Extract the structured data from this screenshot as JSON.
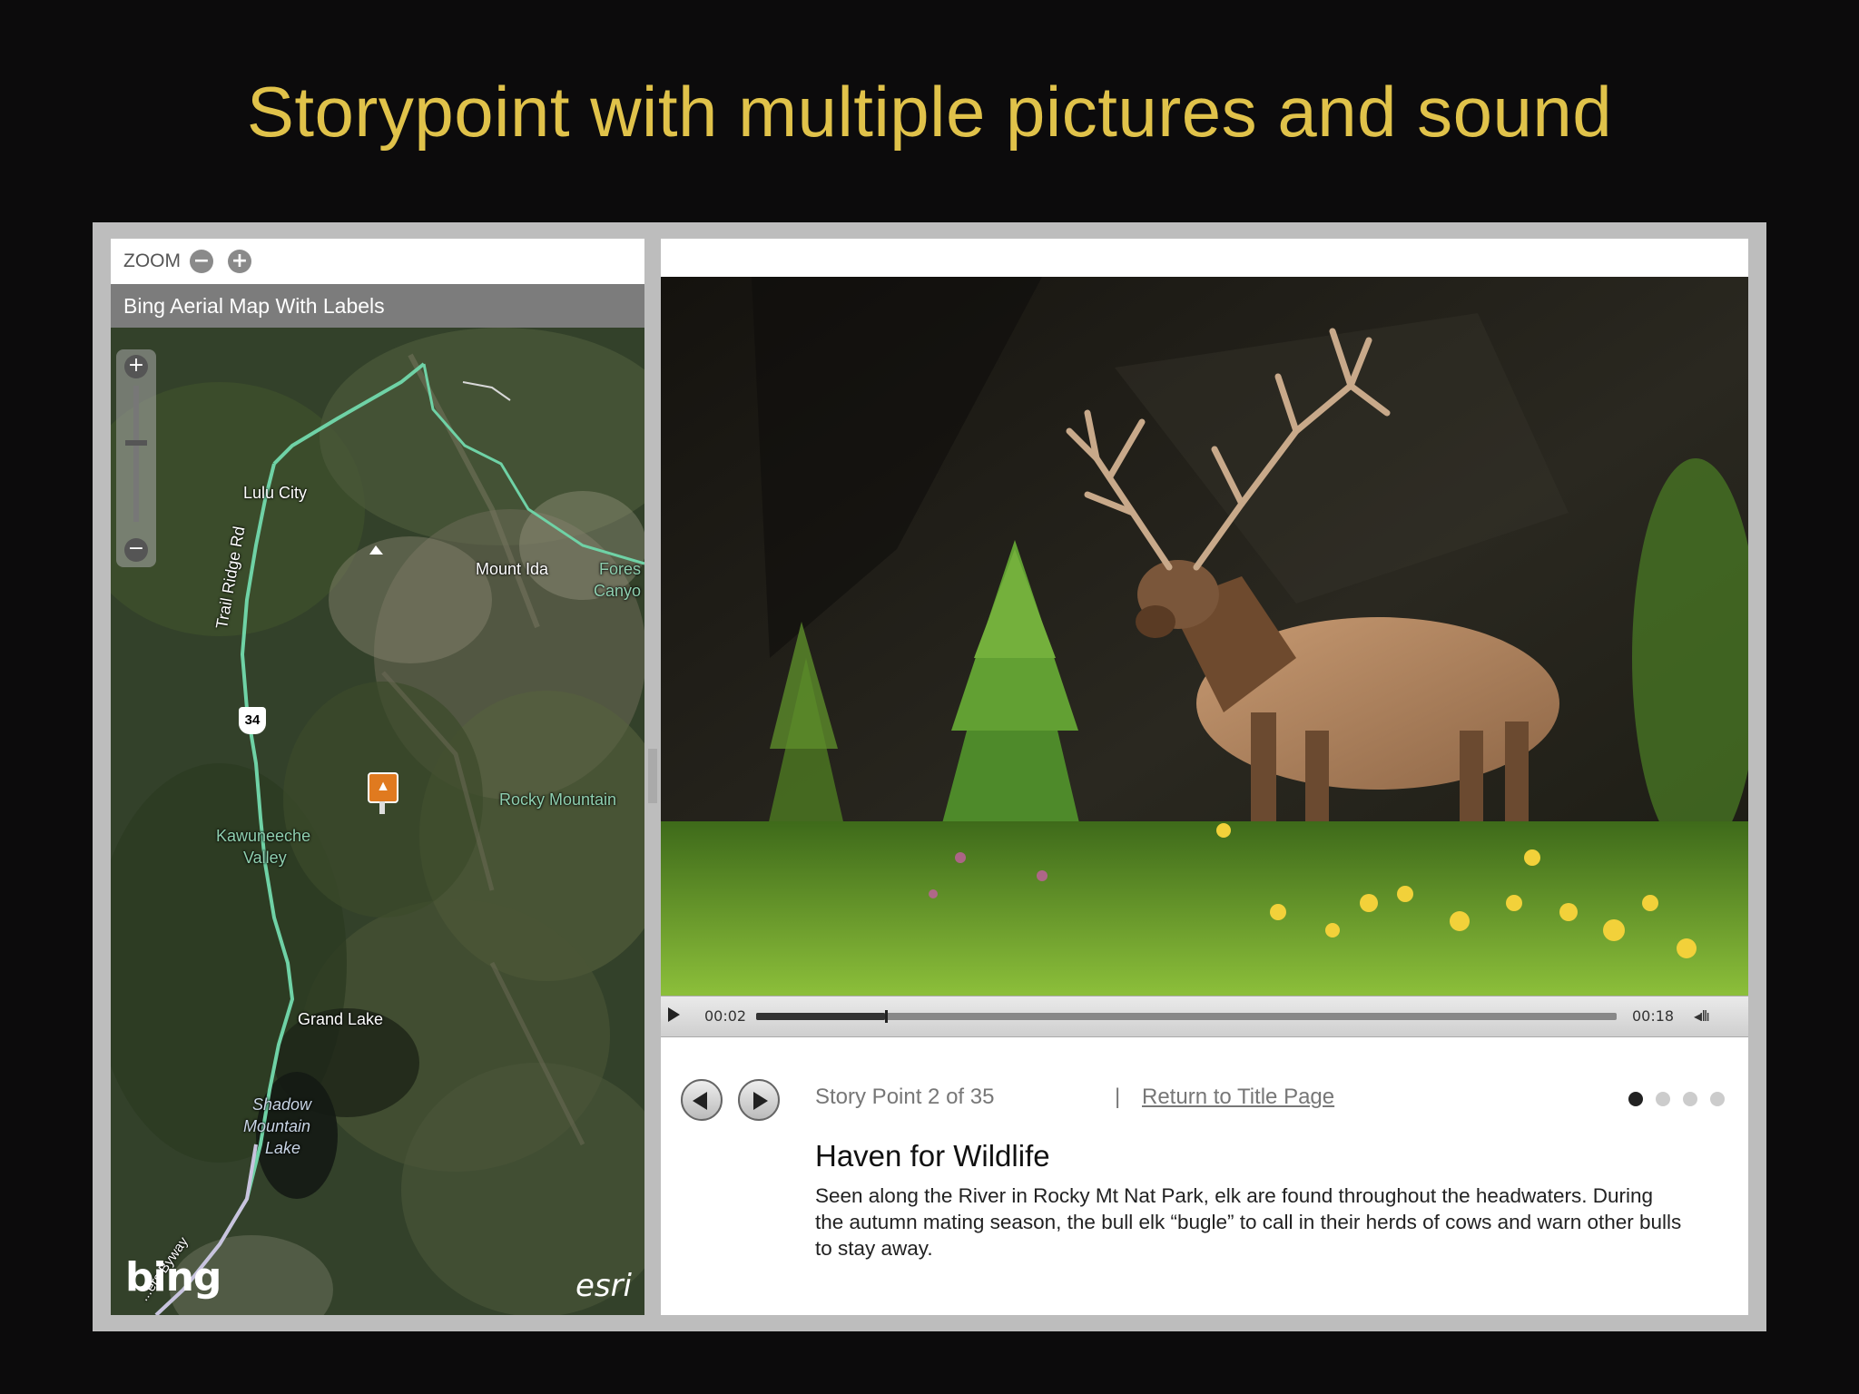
{
  "slide": {
    "title": "Storypoint with multiple pictures and sound"
  },
  "map_panel": {
    "zoom_label": "ZOOM",
    "zoom_out_icon": "minus-icon",
    "zoom_in_icon": "plus-icon",
    "basemap_title": "Bing Aerial Map With Labels",
    "labels": {
      "lulu_city": "Lulu City",
      "trail_ridge": "Trail Ridge Rd",
      "mount_ida": "Mount Ida",
      "forest_canyon_1": "Fores",
      "forest_canyon_2": "Canyo",
      "highway": "34",
      "rocky_mountain": "Rocky Mountain",
      "kawuneeche_1": "Kawuneeche",
      "kawuneeche_2": "Valley",
      "grand_lake": "Grand Lake",
      "shadow_1": "Shadow",
      "shadow_2": "Mountain",
      "shadow_3": "Lake",
      "byway": "...ers Byway"
    },
    "bing_logo": "bing",
    "esri_logo": "esri"
  },
  "story_panel": {
    "photo_subject": "bull elk in meadow",
    "audio": {
      "current_time": "00:02",
      "total_time": "00:18",
      "progress": 0.15
    },
    "nav": {
      "prev_icon": "arrow-left-icon",
      "next_icon": "arrow-right-icon"
    },
    "counter": "Story Point 2 of 35",
    "separator": "|",
    "return_link": "Return to Title Page",
    "image_dots": [
      {
        "active": true
      },
      {
        "active": false
      },
      {
        "active": false
      },
      {
        "active": false
      }
    ],
    "title": "Haven for Wildlife",
    "body": "Seen along the River in Rocky Mt Nat Park, elk are found throughout the headwaters. During the autumn mating season, the bull elk “bugle” to call in their herds of cows and warn other bulls to stay away."
  },
  "colors": {
    "title_gold": "#e0c24a",
    "background": "#0c0b0c",
    "frame_gray": "#bdbdbd",
    "route_green": "#6fd2a6"
  }
}
